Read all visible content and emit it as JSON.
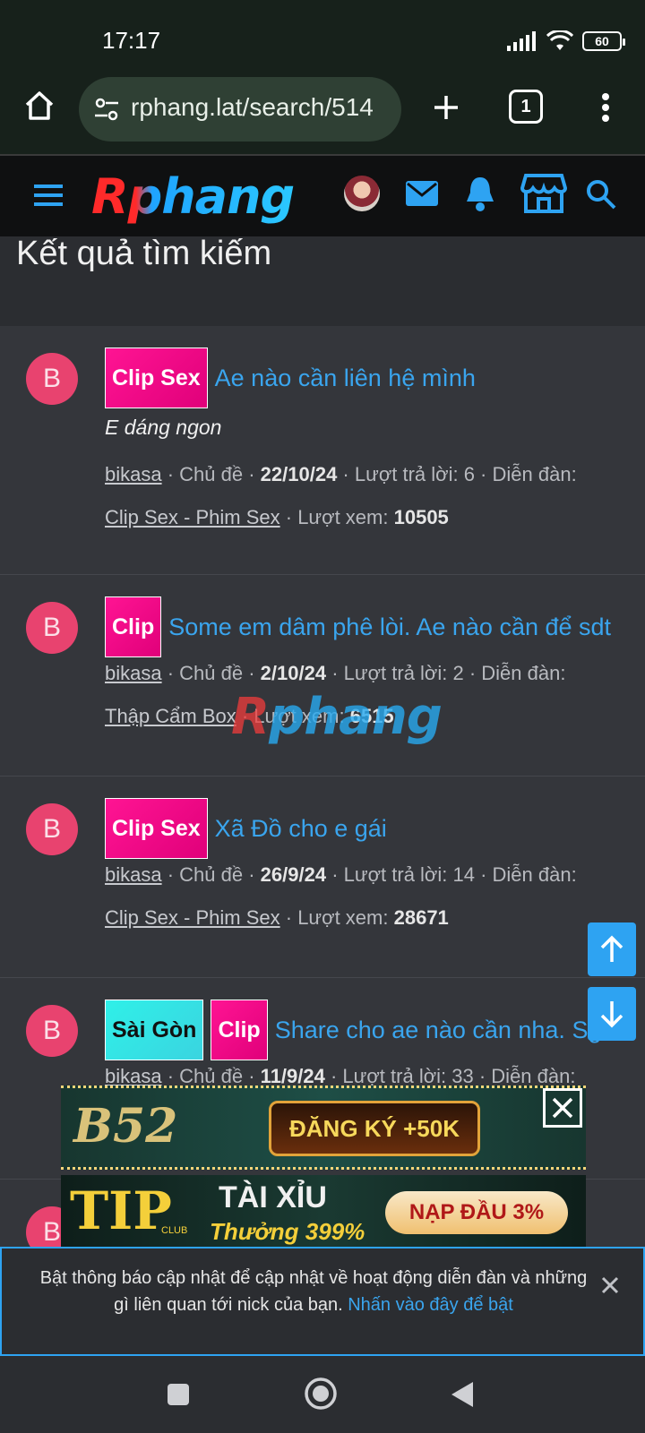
{
  "status_bar": {
    "time": "17:17",
    "battery": "60"
  },
  "browser": {
    "url": "rphang.lat/search/514",
    "tab_count": "1"
  },
  "site": {
    "logo": "Rphang"
  },
  "page": {
    "title": "Kết quả tìm kiếm"
  },
  "results": [
    {
      "avatar_letter": "B",
      "tags": [
        {
          "label": "Clip Sex",
          "color": "pink"
        }
      ],
      "title": "Ae nào cần liên hệ mình",
      "snippet": "E dáng ngon",
      "author": "bikasa",
      "type": "Chủ đề",
      "date": "22/10/24",
      "replies_label": "Lượt trả lời: 6",
      "forum_label": "Diễn đàn:",
      "forum": "Clip Sex - Phim Sex",
      "views_label": "Lượt xem:",
      "views": "10505"
    },
    {
      "avatar_letter": "B",
      "tags": [
        {
          "label": "Clip",
          "color": "pink"
        }
      ],
      "title": "Some em dâm phê lòi. Ae nào cần để sdt",
      "snippet": "",
      "author": "bikasa",
      "type": "Chủ đề",
      "date": "2/10/24",
      "replies_label": "Lượt trả lời: 2",
      "forum_label": "Diễn đàn:",
      "forum": "Thập Cẩm Box",
      "views_label": "Lượt xem:",
      "views": "6515"
    },
    {
      "avatar_letter": "B",
      "tags": [
        {
          "label": "Clip Sex",
          "color": "pink"
        }
      ],
      "title": "Xã Đồ cho e gái",
      "snippet": "",
      "author": "bikasa",
      "type": "Chủ đề",
      "date": "26/9/24",
      "replies_label": "Lượt trả lời: 14",
      "forum_label": "Diễn đàn:",
      "forum": "Clip Sex - Phim Sex",
      "views_label": "Lượt xem:",
      "views": "28671"
    },
    {
      "avatar_letter": "B",
      "tags": [
        {
          "label": "Sài Gòn",
          "color": "cyan"
        },
        {
          "label": "Clip",
          "color": "pink"
        }
      ],
      "title": "Share cho ae nào cần nha. Sg",
      "snippet": "",
      "author": "bikasa",
      "type": "Chủ đề",
      "date": "11/9/24",
      "replies_label": "Lượt trả lời: 33",
      "forum_label": "Diễn đàn:",
      "forum": "",
      "views_label": "",
      "views": ""
    }
  ],
  "watermark": {
    "text": "Rphang"
  },
  "ads": {
    "ad1_brand": "B52",
    "ad1_cta": "ĐĂNG KÝ +50K",
    "ad2_brand": "TIP",
    "ad2_sub": "CLUB",
    "ad2_game": "TÀI XỈU",
    "ad2_bonus": "Thưởng 399%",
    "ad2_cta": "NẠP ĐẦU 3%"
  },
  "notice": {
    "text": "Bật thông báo cập nhật để cập nhật về hoạt động diễn đàn và những gì liên quan tới nick của bạn.",
    "link": "Nhấn vào đây để bật"
  },
  "colors": {
    "accent": "#2ea3f2",
    "link": "#3aa5ee",
    "tag_pink": "#ff1493",
    "avatar": "#e8436f"
  }
}
